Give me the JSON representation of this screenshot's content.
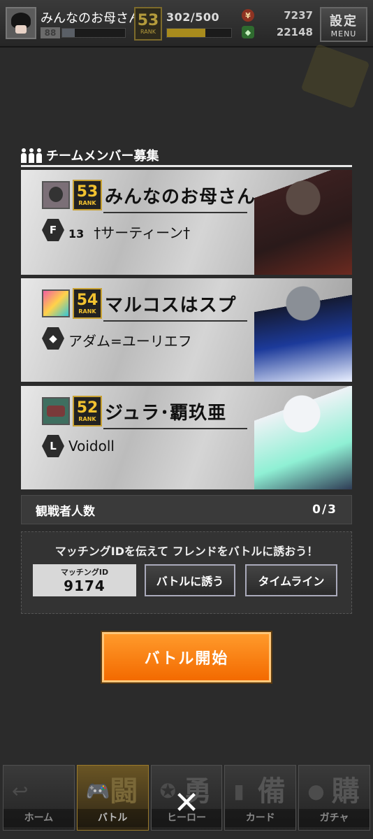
{
  "header": {
    "player_name": "みんなのお母さん",
    "level_text": "88",
    "level_progress": 0.2,
    "rank_num": "53",
    "rank_label": "RANK",
    "exp_text": "302/500",
    "exp_progress": 0.6,
    "currency_1_icon": "coin-icon",
    "currency_1": "7237",
    "currency_2_icon": "gem-icon",
    "currency_2": "22148",
    "settings_label": "設定",
    "menu_label": "MENU"
  },
  "panel": {
    "title": "チームメンバー募集",
    "icon": "team-members-icon"
  },
  "members": [
    {
      "name": "みんなのお母さん",
      "rank": "53",
      "rank_label": "RANK",
      "hero_icon_glyph": "F",
      "hero_level": "13",
      "hero_name": "†サーティーン†"
    },
    {
      "name": "マルコスはスプ",
      "rank": "54",
      "rank_label": "RANK",
      "hero_icon_glyph": "◆",
      "hero_level": "",
      "hero_name": "アダム=ユーリエフ"
    },
    {
      "name": "ジュラ･覇玖亜",
      "rank": "52",
      "rank_label": "RANK",
      "hero_icon_glyph": "L",
      "hero_level": "",
      "hero_name": "Voidoll"
    }
  ],
  "spectators": {
    "label": "観戦者人数",
    "count": "0/3"
  },
  "invite": {
    "message": "マッチングIDを伝えて フレンドをバトルに誘おう！",
    "matching_label": "マッチングID",
    "matching_id": "9174",
    "invite_button": "バトルに誘う",
    "timeline_button": "タイムライン"
  },
  "start_button": "バトル開始",
  "bottom_nav": [
    {
      "label": "ホーム",
      "kanji": "",
      "glyph": "↩",
      "active": false
    },
    {
      "label": "バトル",
      "kanji": "闘",
      "glyph": "",
      "active": true
    },
    {
      "label": "ヒーロー",
      "kanji": "勇",
      "glyph": "",
      "active": false
    },
    {
      "label": "カード",
      "kanji": "備",
      "glyph": "",
      "active": false
    },
    {
      "label": "ガチャ",
      "kanji": "購",
      "glyph": "",
      "active": false
    }
  ],
  "close_glyph": "✕"
}
